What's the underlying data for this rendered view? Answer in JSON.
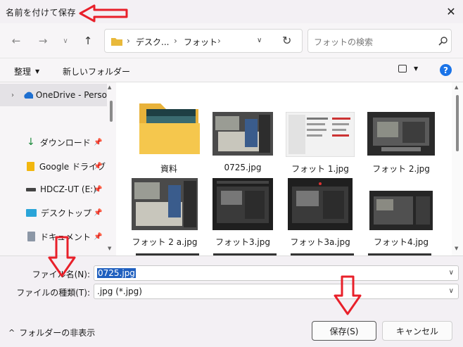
{
  "window": {
    "title": "名前を付けて保存"
  },
  "nav": {
    "breadcrumb": [
      "デスク...",
      "フォット"
    ],
    "search_placeholder": "フォットの検索"
  },
  "command_bar": {
    "organize_label": "整理",
    "new_folder_label": "新しいフォルダー"
  },
  "sidebar": {
    "items": [
      {
        "label": "OneDrive - Perso",
        "icon": "cloud-icon"
      },
      {
        "label": "ダウンロード",
        "icon": "download-icon"
      },
      {
        "label": "Google ドライブ",
        "icon": "google-drive-icon"
      },
      {
        "label": "HDCZ-UT (E:)",
        "icon": "drive-icon"
      },
      {
        "label": "デスクトップ",
        "icon": "desktop-icon"
      },
      {
        "label": "ドキュメント",
        "icon": "document-icon"
      }
    ]
  },
  "files": [
    {
      "label": "資料",
      "kind": "folder"
    },
    {
      "label": "0725.jpg",
      "kind": "photo"
    },
    {
      "label": "フォット 1.jpg",
      "kind": "screenshot"
    },
    {
      "label": "フォット 2.jpg",
      "kind": "photo"
    },
    {
      "label": "フォット 2 a.jpg",
      "kind": "photo"
    },
    {
      "label": "フォット3.jpg",
      "kind": "dark"
    },
    {
      "label": "フォット3a.jpg",
      "kind": "dark"
    },
    {
      "label": "フォット4.jpg",
      "kind": "dark"
    }
  ],
  "form": {
    "filename_label": "ファイル名(N):",
    "filename_value": "0725.jpg",
    "filetype_label": "ファイルの種類(T):",
    "filetype_value": ".jpg (*.jpg)"
  },
  "footer": {
    "hide_folders_label": "フォルダーの非表示",
    "save_label": "保存(S)",
    "cancel_label": "キャンセル"
  },
  "colors": {
    "accent": "#1f5fbf",
    "annotation_arrow": "#e8202a",
    "folder": "#f5c342",
    "help": "#1a73e8"
  }
}
